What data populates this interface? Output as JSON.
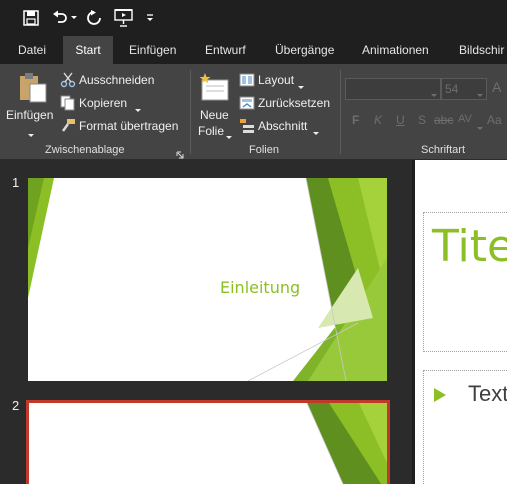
{
  "quick_access": {
    "icons": [
      "save-icon",
      "undo-icon",
      "redo-icon",
      "start-slideshow-icon",
      "customize-qat-icon"
    ]
  },
  "tabs": [
    {
      "label": "Datei"
    },
    {
      "label": "Start"
    },
    {
      "label": "Einfügen"
    },
    {
      "label": "Entwurf"
    },
    {
      "label": "Übergänge"
    },
    {
      "label": "Animationen"
    },
    {
      "label": "Bildschir"
    }
  ],
  "active_tab": "Start",
  "ribbon": {
    "clipboard": {
      "paste_label": "Einfügen",
      "cut_label": "Ausschneiden",
      "copy_label": "Kopieren",
      "format_painter_label": "Format übertragen",
      "group_label": "Zwischenablage"
    },
    "slides": {
      "new_slide_line1": "Neue",
      "new_slide_line2": "Folie",
      "layout_label": "Layout",
      "reset_label": "Zurücksetzen",
      "section_label": "Abschnitt",
      "group_label": "Folien"
    },
    "font": {
      "size_value": "54",
      "group_label": "Schriftart",
      "format_buttons": [
        "F",
        "K",
        "U",
        "S"
      ],
      "spacing_label": "AV",
      "case_label": "Aa"
    }
  },
  "thumbnails": [
    {
      "number": "1",
      "title": "Einleitung"
    },
    {
      "number": "2"
    }
  ],
  "editor": {
    "title_text": "Tite",
    "body_text": "Text"
  },
  "colors": {
    "accent_green": "#8cbf26",
    "selection_border": "#c0392b",
    "ribbon_bg": "#444444",
    "titlebar_bg": "#1f1f1f"
  }
}
